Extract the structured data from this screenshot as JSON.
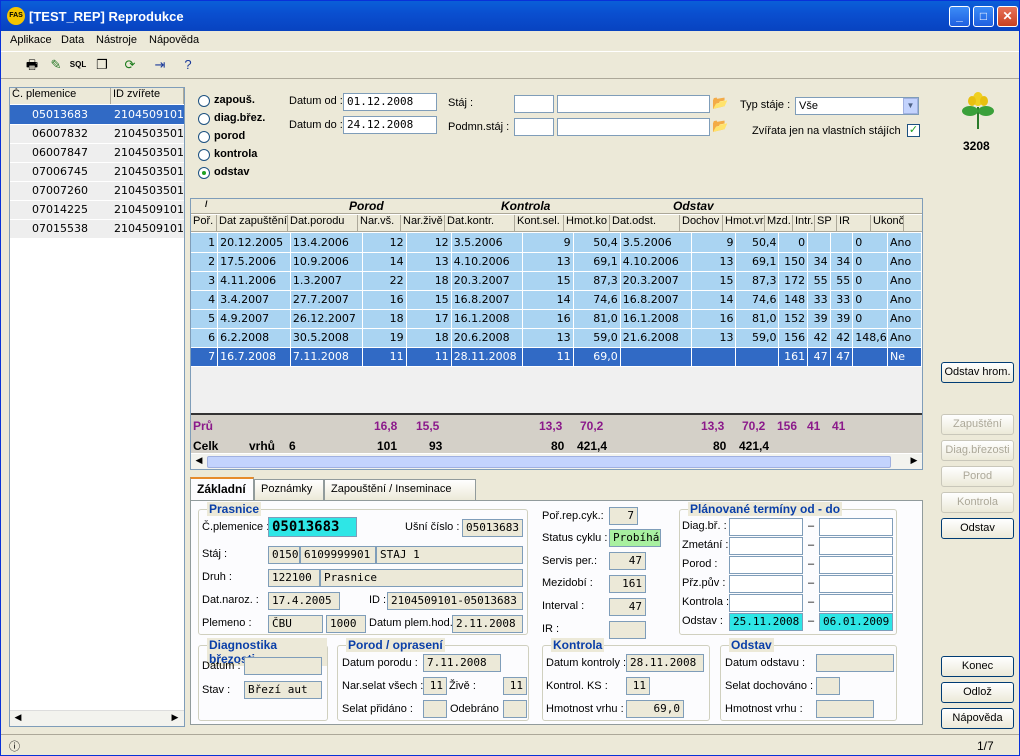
{
  "window": {
    "title": "[TEST_REP] Reprodukce",
    "app_badge": "FAS"
  },
  "menu": [
    "Aplikace",
    "Data",
    "Nástroje",
    "Nápověda"
  ],
  "toolbar": {
    "sql_label": "SQL"
  },
  "left_list": {
    "headers": [
      "Č. plemenice",
      "ID zvířete"
    ],
    "rows": [
      [
        "05013683",
        "2104509101"
      ],
      [
        "06007832",
        "2104503501"
      ],
      [
        "06007847",
        "2104503501"
      ],
      [
        "07006745",
        "2104503501"
      ],
      [
        "07007260",
        "2104503501"
      ],
      [
        "07014225",
        "2104509101"
      ],
      [
        "07015538",
        "2104509101"
      ]
    ],
    "selected_index": 0
  },
  "filters": {
    "radios": [
      "zapouš.",
      "diag.břez.",
      "porod",
      "kontrola",
      "odstav"
    ],
    "selected_radio": "odstav",
    "date_from_label": "Datum od :",
    "date_from": "01.12.2008",
    "date_to_label": "Datum do :",
    "date_to": "24.12.2008",
    "stable_label": "Stáj :",
    "stable_sub_label": "Podmn.stáj :",
    "stable_type_label": "Typ stáje :",
    "stable_type": "Vše",
    "own_stables_label": "Zvířata jen na vlastních stájích",
    "own_stables_checked": true
  },
  "logo": {
    "number": "3208"
  },
  "grid": {
    "groups": [
      "Porod",
      "Kontrola",
      "Odstav"
    ],
    "columns": [
      "Poř.",
      "Dat zapuštění",
      "Dat.porodu",
      "Nar.vš.",
      "Nar.živě",
      "Dat.kontr.",
      "Kont.sel.",
      "Hmot.ko",
      "Dat.odst.",
      "Dochov",
      "Hmot.vr.",
      "Mzd.",
      "Intr.",
      "SP",
      "IR",
      "Ukonč."
    ],
    "rows": [
      [
        "1",
        "20.12.2005",
        "13.4.2006",
        "12",
        "12",
        "3.5.2006",
        "9",
        "50,4",
        "3.5.2006",
        "9",
        "50,4",
        "0",
        "",
        "",
        "0",
        "Ano"
      ],
      [
        "2",
        "17.5.2006",
        "10.9.2006",
        "14",
        "13",
        "4.10.2006",
        "13",
        "69,1",
        "4.10.2006",
        "13",
        "69,1",
        "150",
        "34",
        "34",
        "0",
        "Ano"
      ],
      [
        "3",
        "4.11.2006",
        "1.3.2007",
        "22",
        "18",
        "20.3.2007",
        "15",
        "87,3",
        "20.3.2007",
        "15",
        "87,3",
        "172",
        "55",
        "55",
        "0",
        "Ano"
      ],
      [
        "4",
        "3.4.2007",
        "27.7.2007",
        "16",
        "15",
        "16.8.2007",
        "14",
        "74,6",
        "16.8.2007",
        "14",
        "74,6",
        "148",
        "33",
        "33",
        "0",
        "Ano"
      ],
      [
        "5",
        "4.9.2007",
        "26.12.2007",
        "18",
        "17",
        "16.1.2008",
        "16",
        "81,0",
        "16.1.2008",
        "16",
        "81,0",
        "152",
        "39",
        "39",
        "0",
        "Ano"
      ],
      [
        "6",
        "6.2.2008",
        "30.5.2008",
        "19",
        "18",
        "20.6.2008",
        "13",
        "59,0",
        "21.6.2008",
        "13",
        "59,0",
        "156",
        "42",
        "42",
        "148,6",
        "Ano"
      ],
      [
        "7",
        "16.7.2008",
        "7.11.2008",
        "11",
        "11",
        "28.11.2008",
        "11",
        "69,0",
        "",
        "",
        "",
        "161",
        "47",
        "47",
        "",
        "Ne"
      ]
    ],
    "selected_row": 6,
    "avg": {
      "label": "Prů",
      "nar_vs": "16,8",
      "nar_zive": "15,5",
      "kont_sel": "13,3",
      "hmot_ko": "70,2",
      "dochov": "13,3",
      "hmot_vr": "70,2",
      "mzd": "156",
      "intr": "41",
      "sp": "41"
    },
    "total": {
      "label": "Celk",
      "vrhu_label": "vrhů",
      "vrhu": "6",
      "nar_vs": "101",
      "nar_zive": "93",
      "kont_sel": "80",
      "hmot_ko": "421,4",
      "dochov": "80",
      "hmot_vr": "421,4"
    }
  },
  "tabs": [
    "Základní",
    "Poznámky",
    "Zapouštění / Inseminace"
  ],
  "detail": {
    "prasnice": {
      "title": "Prasnice",
      "cplem_label": "Č.plemenice :",
      "cplem": "05013683",
      "usni_label": "Ušní číslo :",
      "usni": "05013683",
      "staj_label": "Stáj :",
      "staj_code": "0150",
      "staj_id": "6109999901",
      "staj_name": "STAJ 1",
      "druh_label": "Druh :",
      "druh_code": "122100",
      "druh_name": "Prasnice",
      "datnar_label": "Dat.naroz. :",
      "datnar": "17.4.2005",
      "id_label": "ID :",
      "id": "2104509101-05013683",
      "plemeno_label": "Plemeno :",
      "plemeno": "ČBU",
      "plemeno_num": "1000",
      "datplem_label": "Datum plem.hod.:",
      "datplem": "2.11.2008"
    },
    "cycle": {
      "porcyk_label": "Poř.rep.cyk.:",
      "porcyk": "7",
      "status_label": "Status cyklu :",
      "status": "Probíhá",
      "servis_label": "Servis per.:",
      "servis": "47",
      "mezidobi_label": "Mezidobí :",
      "mezidobi": "161",
      "interval_label": "Interval :",
      "interval": "47",
      "ir_label": "IR :",
      "ir": ""
    },
    "planned": {
      "title": "Plánované termíny od - do",
      "rows": [
        {
          "label": "Diag.bř. :",
          "from": "",
          "to": ""
        },
        {
          "label": "Zmetání :",
          "from": "",
          "to": ""
        },
        {
          "label": "Porod :",
          "from": "",
          "to": ""
        },
        {
          "label": "Přz.pův :",
          "from": "",
          "to": ""
        },
        {
          "label": "Kontrola :",
          "from": "",
          "to": ""
        },
        {
          "label": "Odstav :",
          "from": "25.11.2008",
          "to": "06.01.2009"
        }
      ]
    },
    "diag": {
      "title": "Diagnostika březosti",
      "datum_label": "Datum :",
      "datum": "",
      "stav_label": "Stav :",
      "stav": "Březí aut"
    },
    "porod": {
      "title": "Porod / oprasení",
      "datum_label": "Datum porodu :",
      "datum": "7.11.2008",
      "narsel_label": "Nar.selat všech :",
      "narsel": "11",
      "zive_label": "Živě :",
      "zive": "11",
      "pridano_label": "Selat přidáno :",
      "pridano": "",
      "odebrano_label": "Odebráno :",
      "odebrano": ""
    },
    "kontrola": {
      "title": "Kontrola",
      "datum_label": "Datum kontroly :",
      "datum": "28.11.2008",
      "ks_label": "Kontrol. KS :",
      "ks": "11",
      "hmot_label": "Hmotnost vrhu :",
      "hmot": "69,0"
    },
    "odstav": {
      "title": "Odstav",
      "datum_label": "Datum odstavu :",
      "datum": "",
      "selat_label": "Selat dochováno :",
      "selat": "",
      "hmot_label": "Hmotnost vrhu :",
      "hmot": ""
    }
  },
  "right_buttons": {
    "odstav_hrom": "Odstav hrom.",
    "zapusteni": "Zapuštění",
    "diag": "Diag.březosti",
    "porod": "Porod",
    "kontrola": "Kontrola",
    "odstav": "Odstav",
    "konec": "Konec",
    "odloz": "Odlož",
    "napoveda": "Nápověda"
  },
  "status": {
    "page": "1/7"
  },
  "colors": {
    "row": "#aad4f2",
    "selected": "#316ac5",
    "avg_text": "#8b1a8b",
    "highlight": "#2ee6e6",
    "status_green": "#a8f0a0"
  }
}
